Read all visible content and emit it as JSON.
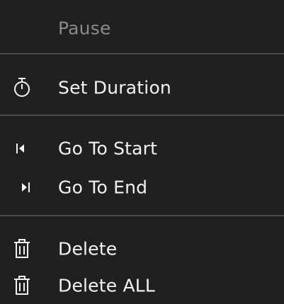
{
  "menu": {
    "items": [
      {
        "label": "Pause",
        "icon": "none",
        "disabled": true
      },
      {
        "label": "Set Duration",
        "icon": "timer-icon"
      },
      {
        "label": "Go To Start",
        "icon": "skip-to-start-icon"
      },
      {
        "label": "Go To End",
        "icon": "skip-to-end-icon"
      },
      {
        "label": "Delete",
        "icon": "trash-icon"
      },
      {
        "label": "Delete ALL",
        "icon": "trash-icon"
      }
    ]
  },
  "colors": {
    "background": "#202020",
    "text": "#f2f2f2",
    "disabled_text": "#8a8a8a",
    "separator": "#4a4a4a"
  }
}
